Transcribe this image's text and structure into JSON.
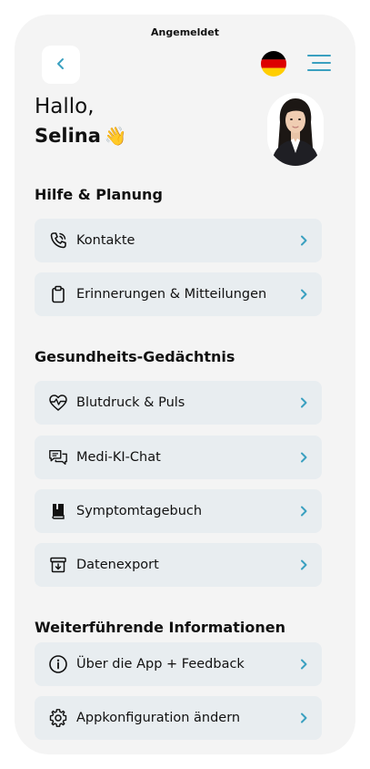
{
  "status_bar": {
    "title": "Angemeldet"
  },
  "header": {
    "back_icon": "chevron-left-icon",
    "flag_icon": "germany-flag-icon",
    "menu_icon": "hamburger-menu-icon"
  },
  "greeting": {
    "hello": "Hallo,",
    "name": "Selina",
    "emoji": "👋"
  },
  "colors": {
    "accent": "#3aa0c0",
    "card_bg": "#e8edf0",
    "screen_bg": "#f4f4f4"
  },
  "sections": [
    {
      "title": "Hilfe & Planung",
      "items": [
        {
          "label": "Kontakte",
          "icon": "phone-call-icon"
        },
        {
          "label": "Erinnerungen & Mitteilungen",
          "icon": "clipboard-icon"
        }
      ]
    },
    {
      "title": "Gesundheits-Gedächtnis",
      "items": [
        {
          "label": "Blutdruck & Puls",
          "icon": "heart-pulse-icon"
        },
        {
          "label": "Medi-KI-Chat",
          "icon": "chat-bubbles-icon"
        },
        {
          "label": "Symptomtagebuch",
          "icon": "book-icon"
        },
        {
          "label": "Datenexport",
          "icon": "archive-download-icon"
        }
      ]
    },
    {
      "title": "Weiterführende Informationen",
      "items": [
        {
          "label": "Über die App + Feedback",
          "icon": "info-icon"
        },
        {
          "label": "Appkonfiguration ändern",
          "icon": "gear-icon"
        }
      ]
    }
  ]
}
